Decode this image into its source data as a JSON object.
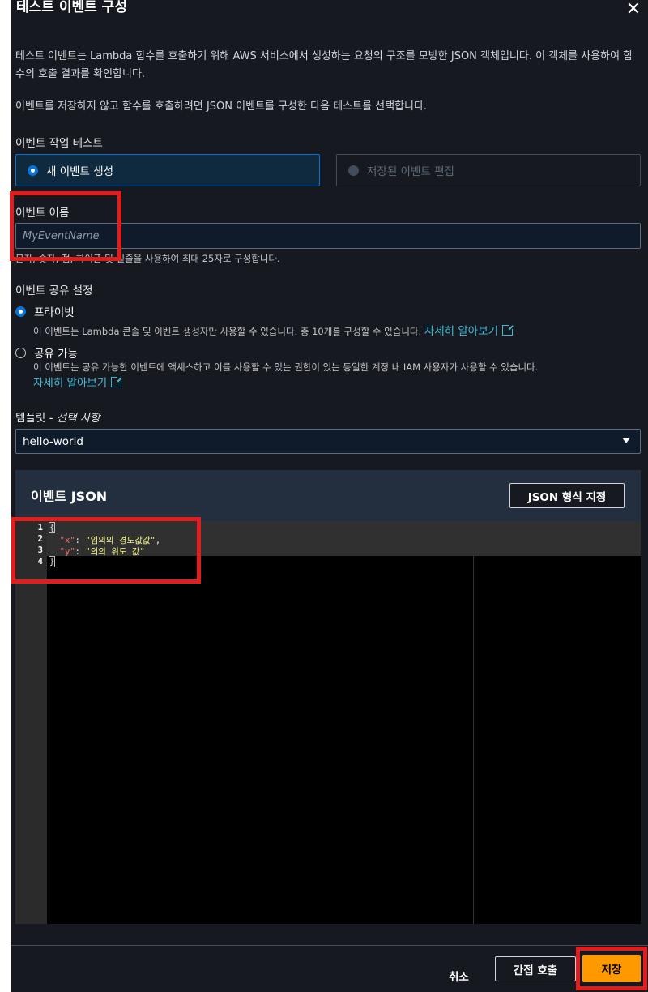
{
  "modal": {
    "title": "테스트 이벤트 구성",
    "close_icon": "close-icon",
    "description_1": "테스트 이벤트는 Lambda 함수를 호출하기 위해 AWS 서비스에서 생성하는 요청의 구조를 모방한 JSON 객체입니다. 이 객체를 사용하여 함수의 호출 결과를 확인합니다.",
    "description_2": "이벤트를 저장하지 않고 함수를 호출하려면 JSON 이벤트를 구성한 다음 테스트를 선택합니다."
  },
  "event_action": {
    "label": "이벤트 작업 테스트",
    "options": [
      {
        "label": "새 이벤트 생성",
        "selected": true
      },
      {
        "label": "저장된 이벤트 편집",
        "disabled": true
      }
    ]
  },
  "event_name": {
    "label": "이벤트 이름",
    "placeholder": "MyEventName",
    "hint": "문자, 숫자, 점, 하이픈 및 밑줄을 사용하여 최대 25자로 구성합니다."
  },
  "sharing": {
    "label": "이벤트 공유 설정",
    "private": {
      "label": "프라이빗",
      "description": "이 이벤트는 Lambda 콘솔 및 이벤트 생성자만 사용할 수 있습니다. 총 10개를 구성할 수 있습니다.",
      "link": "자세히 알아보기"
    },
    "shareable": {
      "label": "공유 가능",
      "description": "이 이벤트는 공유 가능한 이벤트에 액세스하고 이를 사용할 수 있는 권한이 있는 동일한 계정 내 IAM 사용자가 사용할 수 있습니다.",
      "link": "자세히 알아보기"
    }
  },
  "template": {
    "label": "템플릿",
    "label_suffix": "- 선택 사항",
    "value": "hello-world"
  },
  "json_panel": {
    "title": "이벤트 JSON",
    "format_button": "JSON 형식 지정",
    "line_numbers": [
      "1",
      "2",
      "3",
      "4"
    ],
    "lines": {
      "open": "{",
      "key_x": "\"x\"",
      "val_x": "\"임의의 경도값값\"",
      "key_y": "\"y\"",
      "val_y": "\"의의 위도 값\"",
      "close": "}"
    }
  },
  "footer": {
    "cancel": "취소",
    "invoke": "간접 호출",
    "save": "저장"
  },
  "colors": {
    "accent": "#0972d3",
    "primary_button": "#ff9900",
    "annotation": "#e11d1d",
    "link": "#44b9d6"
  }
}
